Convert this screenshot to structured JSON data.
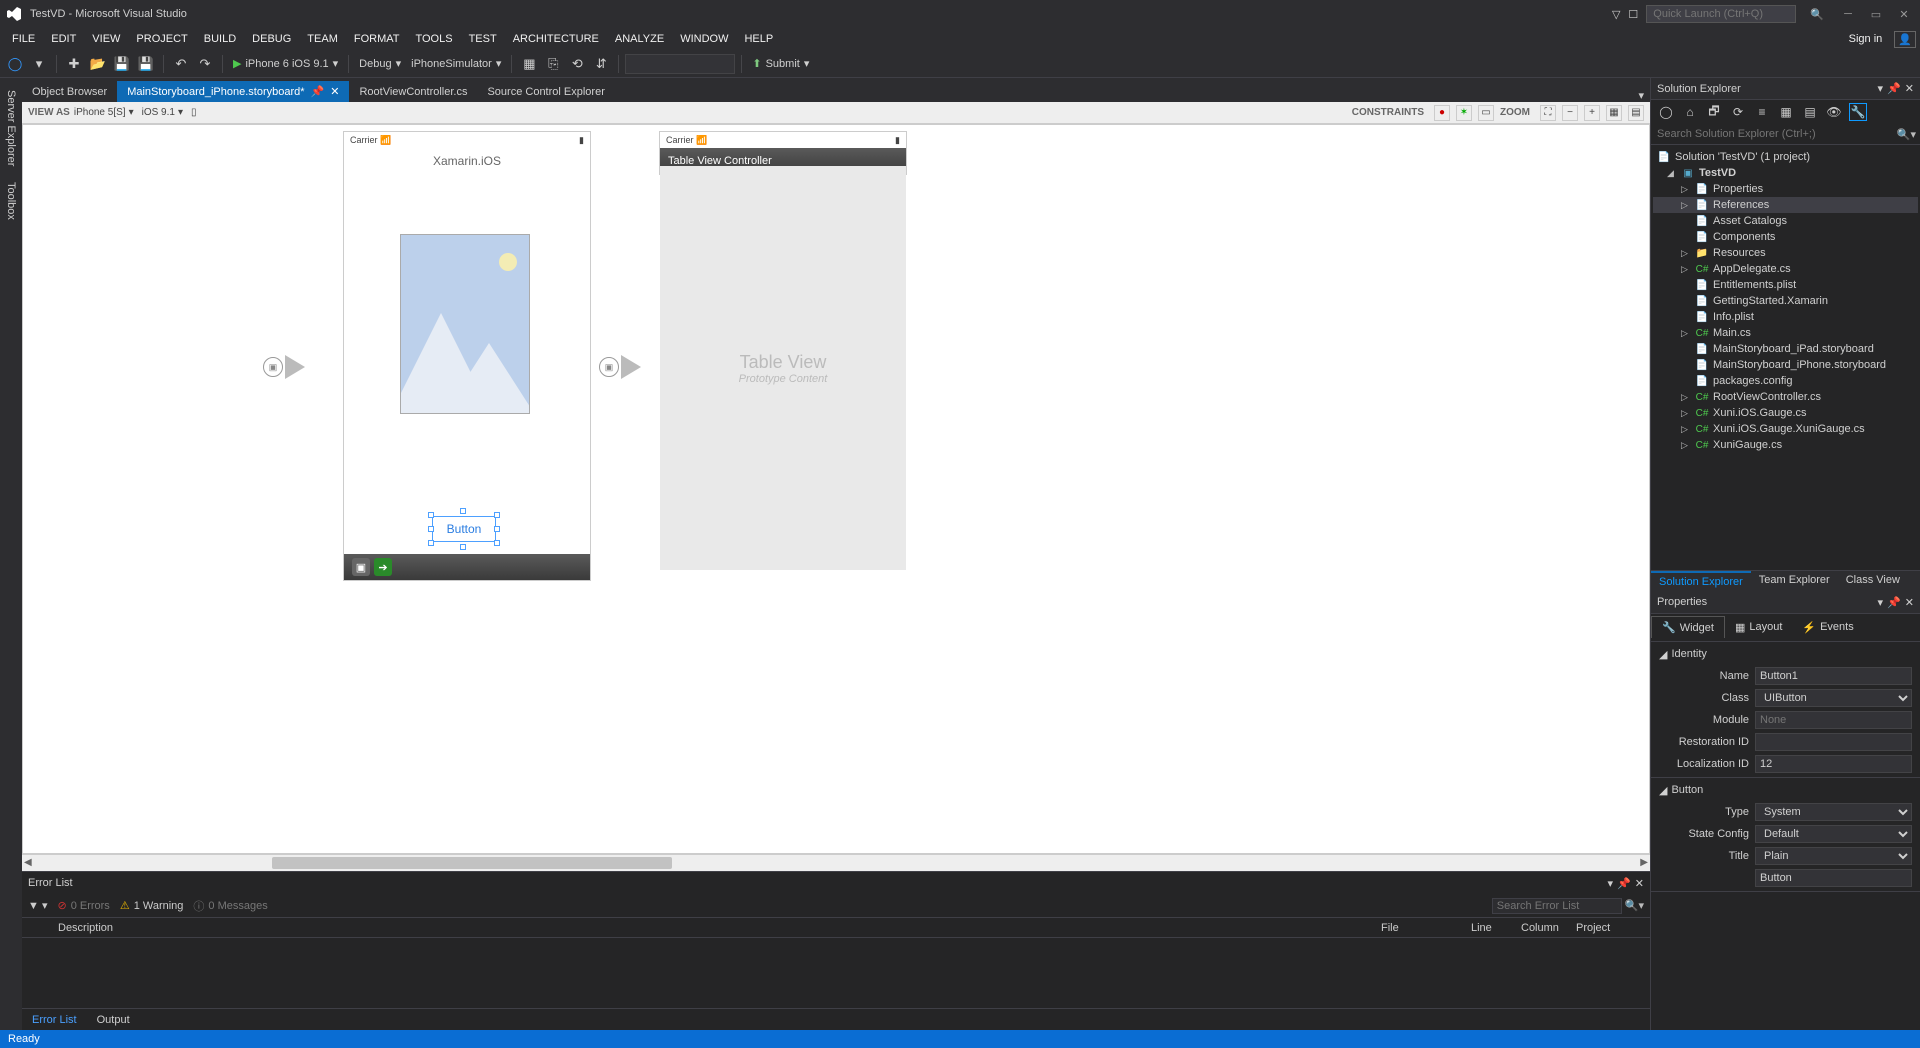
{
  "window": {
    "title": "TestVD - Microsoft Visual Studio",
    "quickLaunchPlaceholder": "Quick Launch (Ctrl+Q)",
    "signIn": "Sign in"
  },
  "menu": [
    "FILE",
    "EDIT",
    "VIEW",
    "PROJECT",
    "BUILD",
    "DEBUG",
    "TEAM",
    "FORMAT",
    "TOOLS",
    "TEST",
    "ARCHITECTURE",
    "ANALYZE",
    "WINDOW",
    "HELP"
  ],
  "toolbar": {
    "startTarget": "iPhone 6 iOS 9.1",
    "config": "Debug",
    "platform": "iPhoneSimulator",
    "submit": "Submit"
  },
  "tabs": [
    {
      "label": "Object Browser",
      "active": false
    },
    {
      "label": "MainStoryboard_iPhone.storyboard*",
      "active": true
    },
    {
      "label": "RootViewController.cs",
      "active": false
    },
    {
      "label": "Source Control Explorer",
      "active": false
    }
  ],
  "designerBar": {
    "viewAsLabel": "VIEW AS",
    "device": "iPhone 5[S]",
    "os": "iOS 9.1",
    "constraints": "CONSTRAINTS",
    "zoom": "ZOOM"
  },
  "scene1": {
    "carrier": "Carrier",
    "title": "Xamarin.iOS",
    "buttonText": "Button"
  },
  "scene2": {
    "carrier": "Carrier",
    "tvTitle": "Table View",
    "tvSub": "Prototype Content",
    "footer": "Table View Controller"
  },
  "errorList": {
    "title": "Error List",
    "errors": "0 Errors",
    "warnings": "1 Warning",
    "messages": "0 Messages",
    "searchPlaceholder": "Search Error List",
    "columns": [
      "",
      "Description",
      "File",
      "Line",
      "Column",
      "Project"
    ],
    "bottomTabs": {
      "active": "Error List",
      "other": "Output"
    }
  },
  "solutionExplorer": {
    "title": "Solution Explorer",
    "searchPlaceholder": "Search Solution Explorer (Ctrl+;)",
    "root": "Solution 'TestVD' (1 project)",
    "project": "TestVD",
    "nodes": [
      {
        "label": "Properties",
        "caret": true
      },
      {
        "label": "References",
        "caret": true,
        "sel": true
      },
      {
        "label": "Asset Catalogs"
      },
      {
        "label": "Components"
      },
      {
        "label": "Resources",
        "caret": true,
        "folder": true
      },
      {
        "label": "AppDelegate.cs",
        "caret": true,
        "cs": true
      },
      {
        "label": "Entitlements.plist"
      },
      {
        "label": "GettingStarted.Xamarin"
      },
      {
        "label": "Info.plist"
      },
      {
        "label": "Main.cs",
        "caret": true,
        "cs": true
      },
      {
        "label": "MainStoryboard_iPad.storyboard"
      },
      {
        "label": "MainStoryboard_iPhone.storyboard"
      },
      {
        "label": "packages.config"
      },
      {
        "label": "RootViewController.cs",
        "caret": true,
        "cs": true
      },
      {
        "label": "Xuni.iOS.Gauge.cs",
        "caret": true,
        "cs": true
      },
      {
        "label": "Xuni.iOS.Gauge.XuniGauge.cs",
        "caret": true,
        "cs": true
      },
      {
        "label": "XuniGauge.cs",
        "caret": true,
        "cs": true
      }
    ],
    "bottomTabs": [
      "Solution Explorer",
      "Team Explorer",
      "Class View"
    ]
  },
  "properties": {
    "title": "Properties",
    "tabs": [
      "Widget",
      "Layout",
      "Events"
    ],
    "identity": {
      "section": "Identity",
      "nameLabel": "Name",
      "name": "Button1",
      "classLabel": "Class",
      "class": "UIButton",
      "moduleLabel": "Module",
      "module": "None",
      "restLabel": "Restoration ID",
      "rest": "",
      "locLabel": "Localization ID",
      "loc": "12"
    },
    "button": {
      "section": "Button",
      "typeLabel": "Type",
      "type": "System",
      "stateLabel": "State Config",
      "state": "Default",
      "titleLabel": "Title",
      "title": "Plain",
      "titleText": "Button"
    }
  },
  "leftRail": [
    "Server Explorer",
    "Toolbox"
  ],
  "status": "Ready"
}
